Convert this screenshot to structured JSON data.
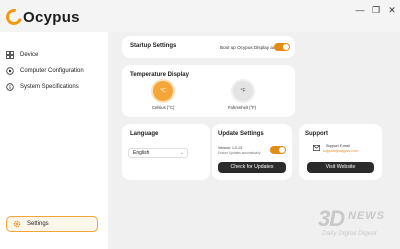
{
  "app": {
    "title": "Ocypus"
  },
  "window": {
    "minimize": "—",
    "restore": "❐",
    "close": "✕"
  },
  "sidebar": {
    "items": [
      {
        "label": "Device",
        "icon": "device-grid-icon"
      },
      {
        "label": "Computer Configuration",
        "icon": "computer-config-icon"
      },
      {
        "label": "System Specifications",
        "icon": "info-icon"
      }
    ],
    "settings": {
      "label": "Settings",
      "icon": "gear-icon"
    }
  },
  "startup": {
    "title": "Startup Settings",
    "autostart_label": "Boot up Ocypus Display auto start",
    "autostart_on": true
  },
  "temperature": {
    "title": "Temperature Display",
    "celsius": {
      "symbol": "°C",
      "label": "Celsius (°C)",
      "selected": true
    },
    "fahrenheit": {
      "symbol": "°F",
      "label": "Fahrenheit (°F)",
      "selected": false
    }
  },
  "language": {
    "title": "Language",
    "selected": "English"
  },
  "update": {
    "title": "Update Settings",
    "version_line": "Version: 1.0.13",
    "auto_line": "Ensure Updates automatically",
    "auto_on": true,
    "check_button": "Check for Updates"
  },
  "support": {
    "title": "Support",
    "email_label": "Support E-mail",
    "email": "support@ocypus.com",
    "visit_button": "Visit Website"
  },
  "watermark": {
    "main": "3D",
    "news": "NEWS",
    "sub": "Daily Digital Digest"
  },
  "colors": {
    "accent": "#e58a12",
    "accent_light": "#f4a63a",
    "dark_button": "#2b2b2b"
  }
}
